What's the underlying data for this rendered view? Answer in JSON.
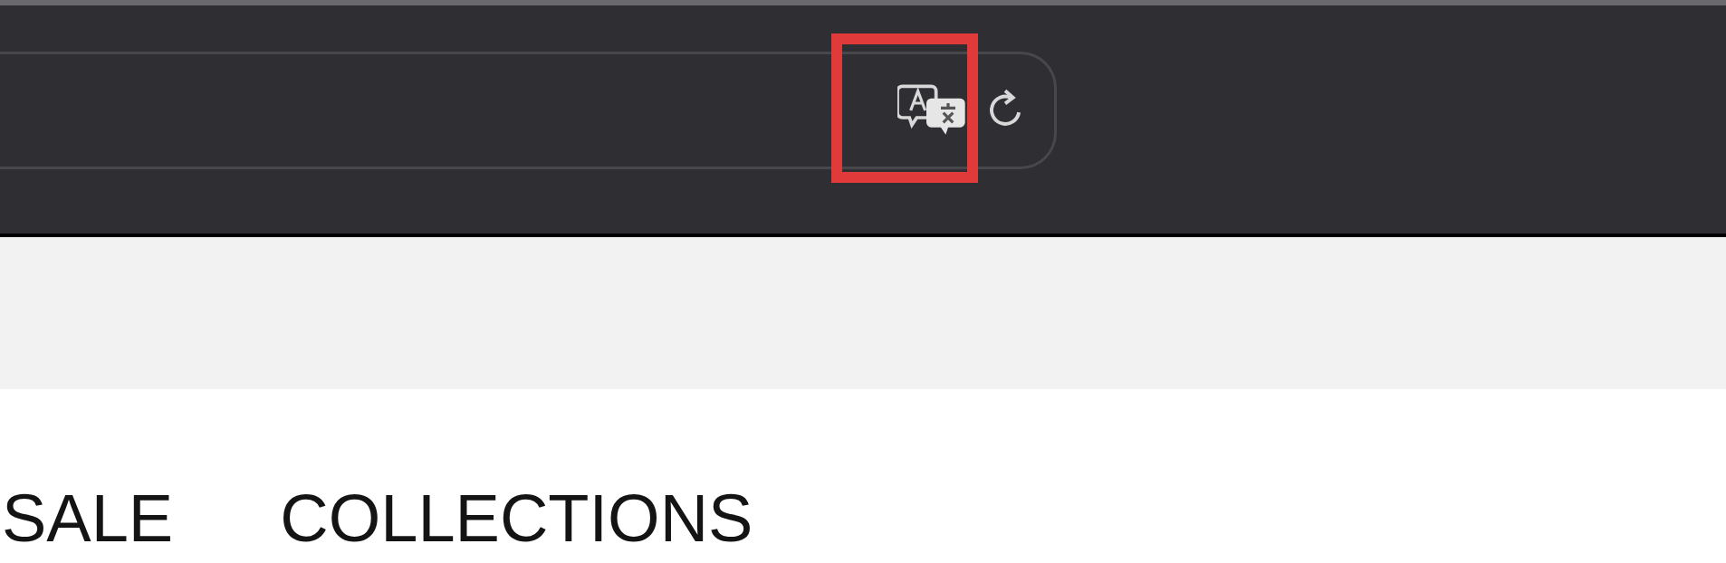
{
  "toolbar": {
    "address_bar": {
      "translate_button": {
        "highlighted": true
      }
    }
  },
  "nav": {
    "items": [
      {
        "label": "SALE"
      },
      {
        "label": "COLLECTIONS"
      }
    ]
  }
}
